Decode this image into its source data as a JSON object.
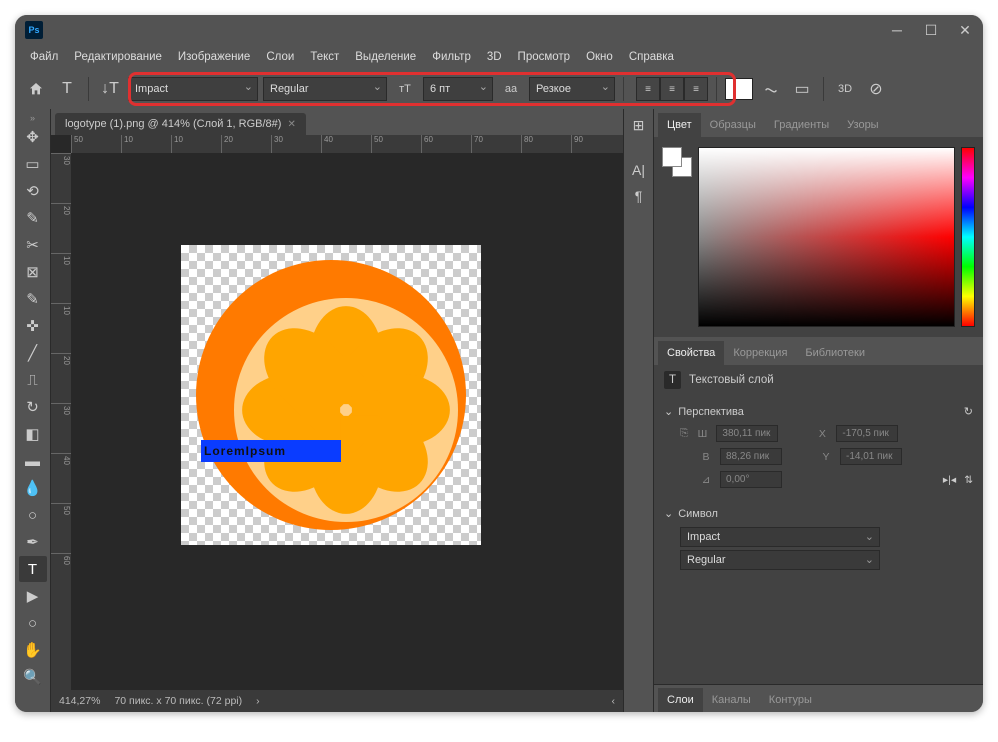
{
  "titlebar": {
    "logo": "Ps"
  },
  "menus": [
    "Файл",
    "Редактирование",
    "Изображение",
    "Слои",
    "Текст",
    "Выделение",
    "Фильтр",
    "3D",
    "Просмотр",
    "Окно",
    "Справка"
  ],
  "optbar": {
    "font": "Impact",
    "style": "Regular",
    "size": "6 пт",
    "aa": "Резкое"
  },
  "doc": {
    "tab": "logotype (1).png @ 414% (Слой 1, RGB/8#)",
    "text_content": "LoremIpsum"
  },
  "rulers": {
    "h": [
      "50",
      "10",
      "10",
      "20",
      "30",
      "40",
      "50",
      "60",
      "70",
      "80",
      "90"
    ],
    "v": [
      "30",
      "20",
      "10",
      "10",
      "20",
      "30",
      "40",
      "50",
      "60"
    ]
  },
  "status": {
    "zoom": "414,27%",
    "dims": "70 пикс. x 70 пикс. (72 ppi)"
  },
  "color_tabs": [
    "Цвет",
    "Образцы",
    "Градиенты",
    "Узоры"
  ],
  "prop_tabs": [
    "Свойства",
    "Коррекция",
    "Библиотеки"
  ],
  "props": {
    "layer_type": "Текстовый слой",
    "sec_transform": "Перспектива",
    "W": "380,11 пик",
    "H": "88,26 пик",
    "X": "-170,5 пик",
    "Y": "-14,01 пик",
    "angle": "0,00°",
    "sec_char": "Символ",
    "font": "Impact",
    "style": "Regular",
    "W_label": "Ш",
    "H_label": "В",
    "X_label": "X",
    "Y_label": "Y"
  },
  "bottom_tabs": [
    "Слои",
    "Каналы",
    "Контуры"
  ]
}
